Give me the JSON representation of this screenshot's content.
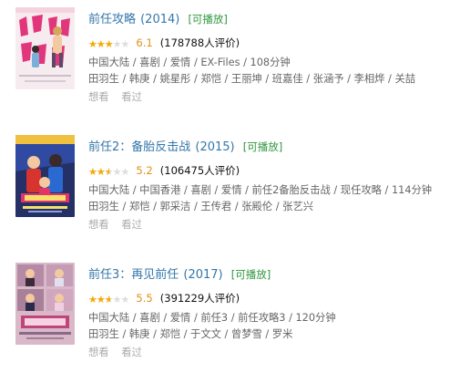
{
  "items": [
    {
      "title": "前任攻略",
      "year": "(2014)",
      "playable": "[可播放]",
      "rating": 6.1,
      "score": "6.1",
      "votes": "(178788人评价)",
      "meta": "中国大陆 / 喜剧 / 爱情 / EX-Files / 108分钟",
      "cast": "田羽生 / 韩庚 / 姚星彤 / 郑恺 / 王丽坤 / 班嘉佳 / 张涵予 / 李相烨 / 关喆",
      "want": "想看",
      "seen": "看过",
      "poster_colors": {
        "bg": "#f6ecef",
        "accent": "#e2367c",
        "figure": "#d4a55a"
      }
    },
    {
      "title": "前任2：备胎反击战",
      "year": "(2015)",
      "playable": "[可播放]",
      "rating": 5.2,
      "score": "5.2",
      "votes": "(106475人评价)",
      "meta": "中国大陆 / 中国香港 / 喜剧 / 爱情 / 前任2备胎反击战 / 现任攻略 / 114分钟",
      "cast": "田羽生 / 郑恺 / 郭采洁 / 王传君 / 张殿伦 / 张艺兴",
      "want": "想看",
      "seen": "看过",
      "poster_colors": {
        "bg": "#243066",
        "accent": "#e0356a",
        "figure": "#f0c040"
      }
    },
    {
      "title": "前任3：再见前任",
      "year": "(2017)",
      "playable": "[可播放]",
      "rating": 5.5,
      "score": "5.5",
      "votes": "(391229人评价)",
      "meta": "中国大陆 / 喜剧 / 爱情 / 前任3 / 前任攻略3 / 120分钟",
      "cast": "田羽生 / 韩庚 / 郑恺 / 于文文 / 曾梦雪 / 罗米",
      "want": "想看",
      "seen": "看过",
      "poster_colors": {
        "bg": "#d9b8c7",
        "accent": "#c0457a",
        "figure": "#8a6a8a"
      }
    }
  ]
}
